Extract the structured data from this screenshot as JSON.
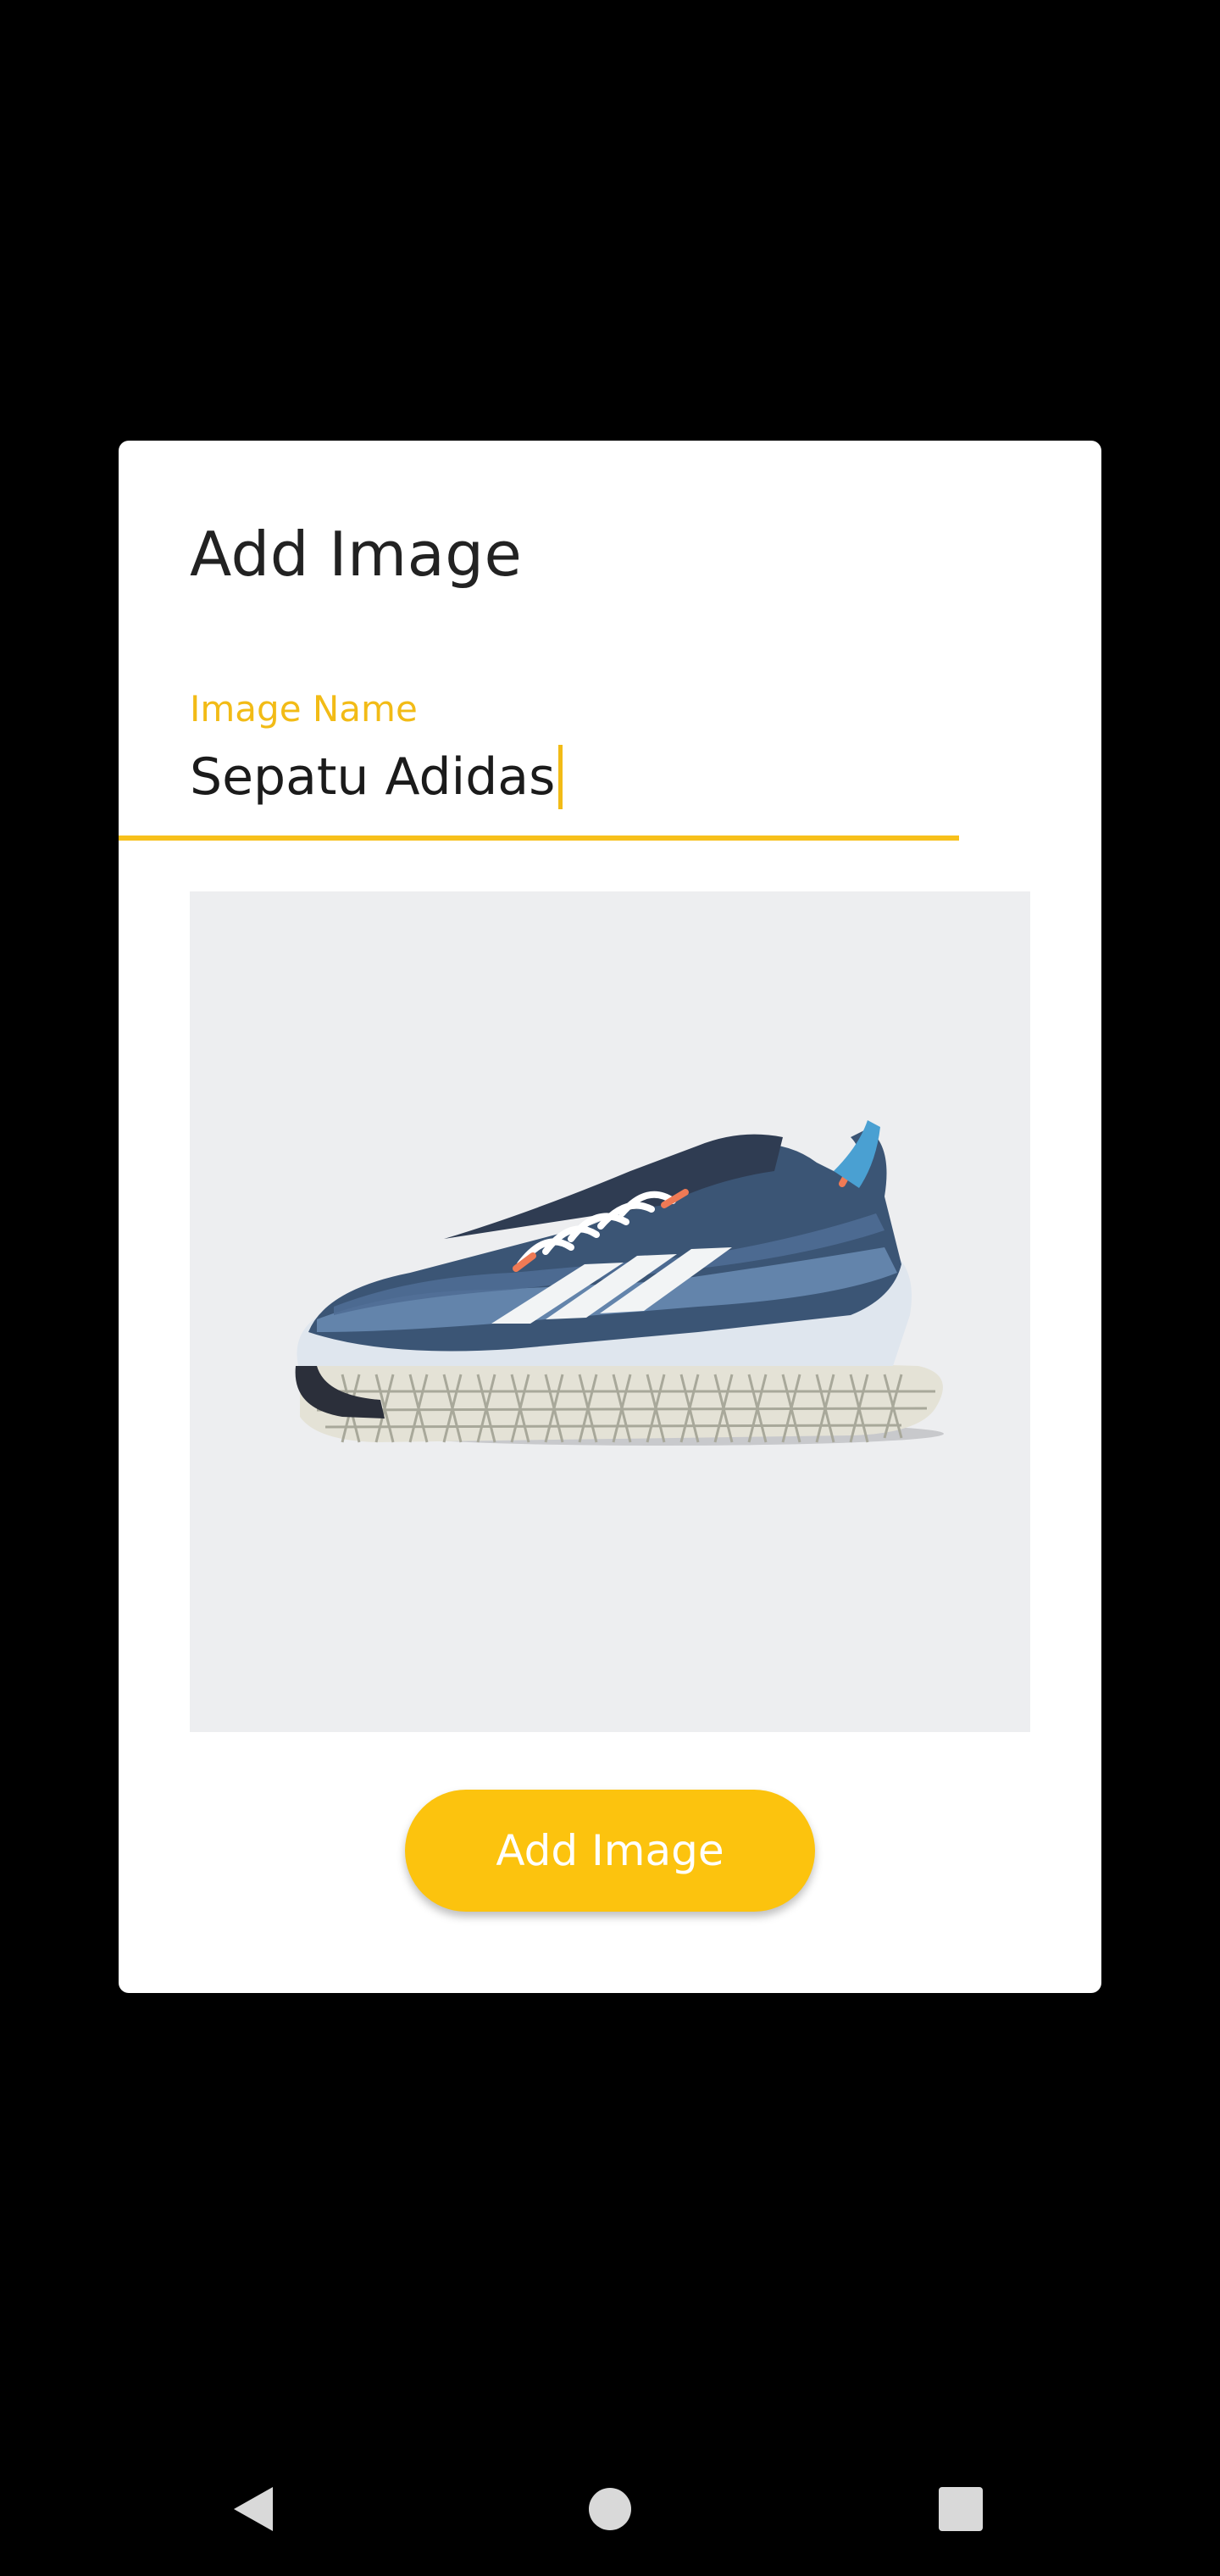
{
  "dialog": {
    "title": "Add Image",
    "image_name_field": {
      "label": "Image Name",
      "value": "Sepatu Adidas"
    },
    "preview_image": {
      "icon": "sneaker-photo",
      "background_color": "#edeef0"
    },
    "add_button_label": "Add Image"
  },
  "colors": {
    "accent": "#fcc30e",
    "label": "#f2bb16",
    "background": "#000000",
    "dialog": "#ffffff"
  },
  "navbar": {
    "back_icon": "back-triangle-icon",
    "home_icon": "home-circle-icon",
    "recents_icon": "recents-square-icon"
  }
}
